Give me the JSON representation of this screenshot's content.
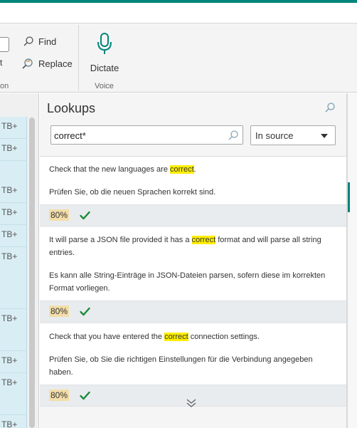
{
  "ribbon": {
    "replace_left_fragment": "t",
    "group_left_fragment": "on",
    "find_label": "Find",
    "replace_label": "Replace",
    "dictate_label": "Dictate",
    "voice_group_label": "Voice"
  },
  "left_list": {
    "items": [
      "TB+",
      "TB+",
      "TB+",
      "TB+",
      "TB+",
      "TB+",
      "TB+",
      "TB+",
      "TB+",
      "TB+"
    ]
  },
  "lookups": {
    "title": "Lookups",
    "search_value": "correct*",
    "scope_selected": "In source",
    "results": [
      {
        "source_before": "Check that the new languages are ",
        "source_match": "correct",
        "source_after": ".",
        "target": "Prüfen Sie, ob die neuen Sprachen korrekt sind.",
        "match_percent": "80%"
      },
      {
        "source_before": "It will parse a JSON file provided it has a ",
        "source_match": "correct",
        "source_after": " format and will parse all string entries.",
        "target": "Es kann alle String-Einträge in JSON-Dateien parsen, sofern diese im korrekten Format vorliegen.",
        "match_percent": "80%"
      },
      {
        "source_before": "Check that you have entered the ",
        "source_match": "correct",
        "source_after": " connection settings.",
        "target": "Prüfen Sie, ob Sie die richtigen Einstellungen für die Verbindung angegeben haben.",
        "match_percent": "80%"
      }
    ]
  },
  "colors": {
    "accent": "#00857a",
    "highlight": "#ffee00",
    "match_badge": "#f3deaa",
    "check": "#1e8a3a"
  },
  "icons": {
    "find": "search-icon",
    "replace": "replace-icon",
    "dictate": "microphone-icon",
    "confirmed": "check-icon",
    "more": "double-chevron-down-icon"
  }
}
